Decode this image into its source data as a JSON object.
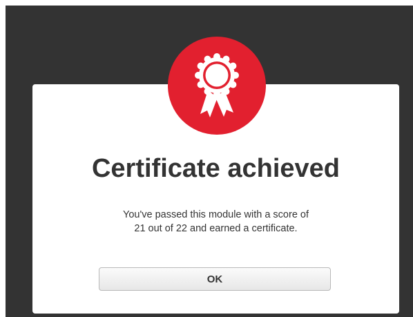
{
  "dialog": {
    "title": "Certificate achieved",
    "message_line1": "You've passed this module with a score of",
    "message_line2": "21 out of 22 and earned a certificate.",
    "ok_label": "OK"
  },
  "badge": {
    "icon": "award-ribbon-icon",
    "color": "#e2202f"
  },
  "colors": {
    "backdrop": "#333333",
    "dialog_background": "#ffffff",
    "text": "#333333"
  }
}
